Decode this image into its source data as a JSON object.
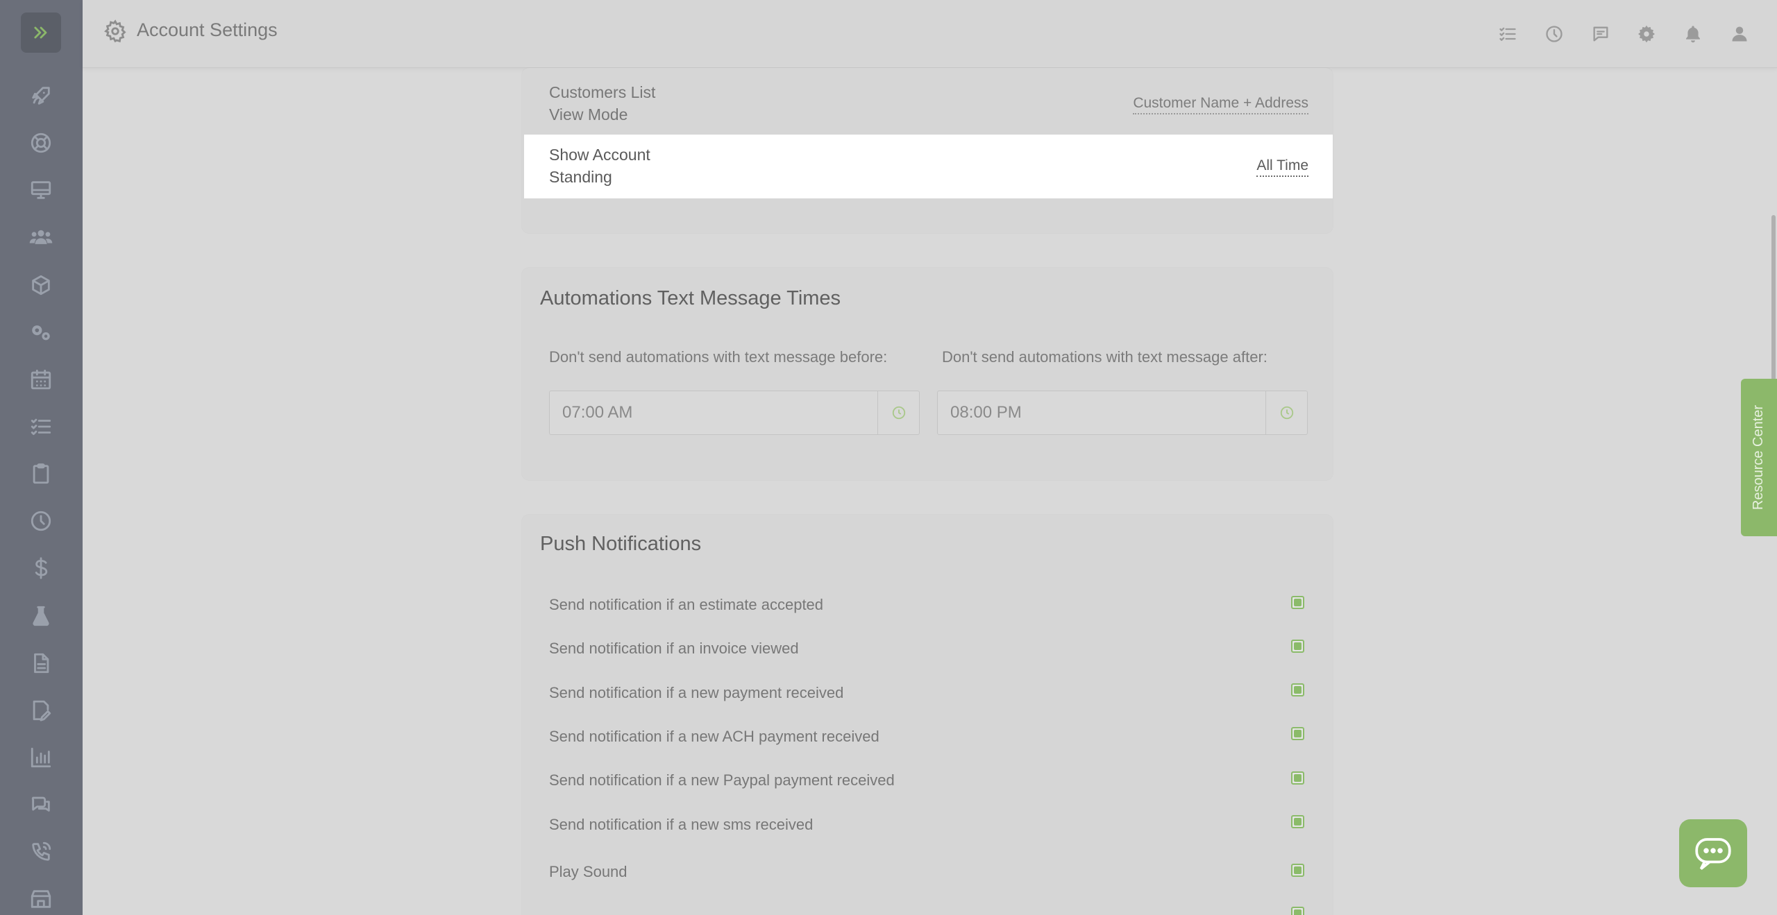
{
  "header": {
    "title": "Account Settings"
  },
  "sidebar": {
    "icons": [
      "rocket-icon",
      "lifebuoy-icon",
      "monitor-icon",
      "users-icon",
      "box-icon",
      "gears-icon",
      "calendar-icon",
      "checklist-icon",
      "clipboard-icon",
      "clock-icon",
      "dollar-icon",
      "flask-icon",
      "document-icon",
      "signature-icon",
      "chart-icon",
      "chat-icon",
      "phone-icon",
      "store-icon"
    ]
  },
  "topbar_icons": [
    "tasks-icon",
    "clock-icon",
    "message-icon",
    "settings-icon",
    "bell-icon",
    "user-icon"
  ],
  "display_settings": {
    "customers_list": {
      "label_line1": "Customers List",
      "label_line2": "View Mode",
      "value": "Customer Name + Address"
    },
    "account_standing": {
      "label_line1": "Show Account",
      "label_line2": "Standing",
      "value": "All Time"
    }
  },
  "automations": {
    "title": "Automations Text Message Times",
    "before_label": "Don't send automations with text message before:",
    "before_value": "07:00 AM",
    "after_label": "Don't send automations with text message after:",
    "after_value": "08:00 PM"
  },
  "push": {
    "title": "Push Notifications",
    "items": [
      {
        "label": "Send notification if an estimate accepted",
        "checked": true
      },
      {
        "label": "Send notification if an invoice viewed",
        "checked": true
      },
      {
        "label": "Send notification if a new payment received",
        "checked": true
      },
      {
        "label": "Send notification if a new ACH payment received",
        "checked": true
      },
      {
        "label": "Send notification if a new Paypal payment received",
        "checked": true
      },
      {
        "label": "Send notification if a new sms received",
        "checked": true
      },
      {
        "label": "Play Sound",
        "checked": true
      }
    ]
  },
  "resource_center": {
    "label": "Resource Center"
  },
  "colors": {
    "accent": "#8cb86a",
    "sidebar": "#6b6f7a"
  }
}
